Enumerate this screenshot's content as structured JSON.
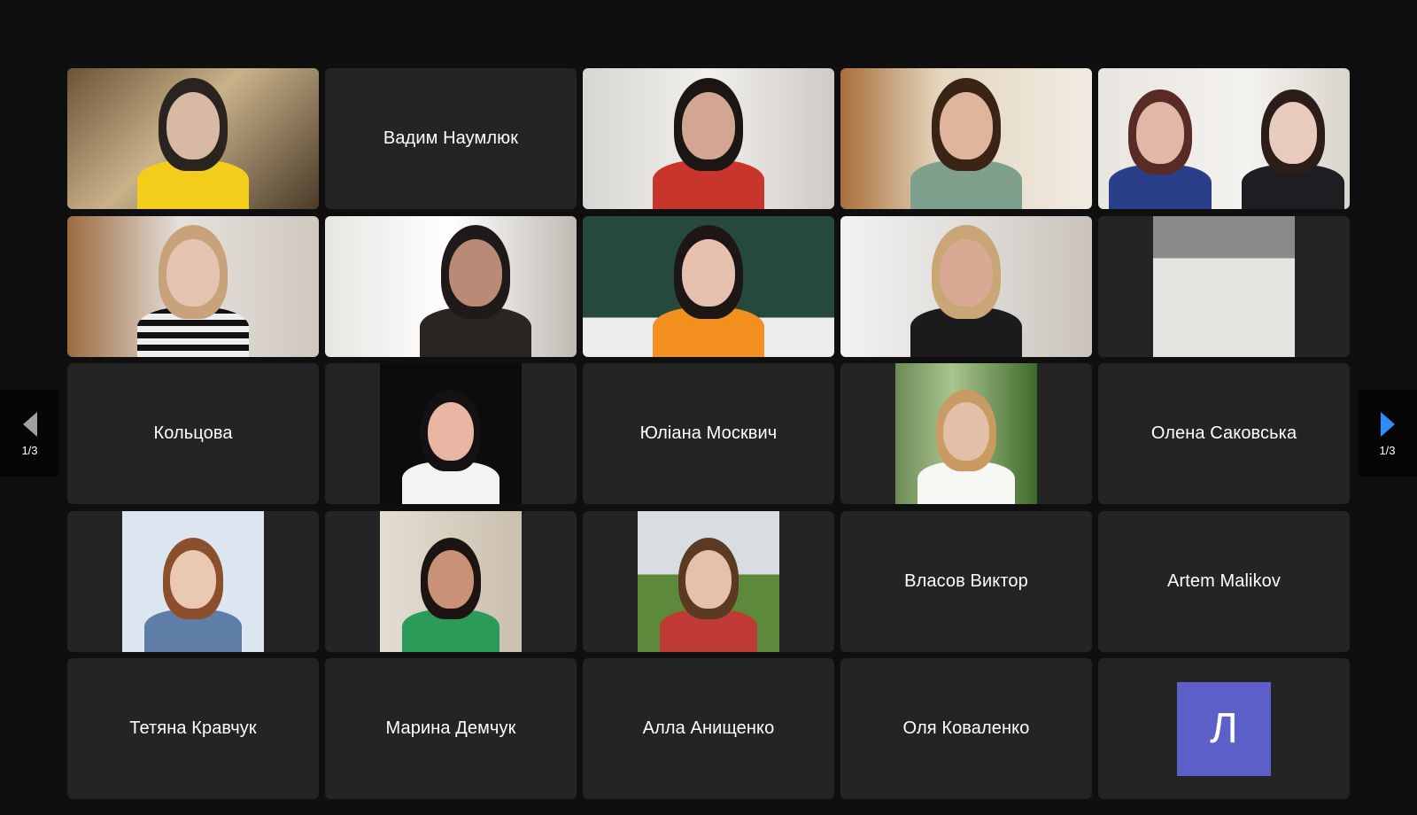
{
  "participants": [
    {
      "name": "",
      "type": "video",
      "active": true
    },
    {
      "name": "Вадим Наумлюк",
      "type": "name"
    },
    {
      "name": "",
      "type": "video"
    },
    {
      "name": "",
      "type": "video"
    },
    {
      "name": "",
      "type": "video"
    },
    {
      "name": "",
      "type": "video"
    },
    {
      "name": "",
      "type": "video"
    },
    {
      "name": "",
      "type": "video"
    },
    {
      "name": "",
      "type": "video"
    },
    {
      "name": "",
      "type": "photo"
    },
    {
      "name": "Кольцова",
      "type": "name"
    },
    {
      "name": "",
      "type": "photo"
    },
    {
      "name": "Юліана Москвич",
      "type": "name"
    },
    {
      "name": "",
      "type": "photo"
    },
    {
      "name": "Олена Саковська",
      "type": "name"
    },
    {
      "name": "",
      "type": "photo"
    },
    {
      "name": "",
      "type": "photo"
    },
    {
      "name": "",
      "type": "photo"
    },
    {
      "name": "Власов Виктор",
      "type": "name"
    },
    {
      "name": "Artem Malikov",
      "type": "name"
    },
    {
      "name": "Тетяна Кравчук",
      "type": "name"
    },
    {
      "name": "Марина Демчук",
      "type": "name"
    },
    {
      "name": "Алла Анищенко",
      "type": "name"
    },
    {
      "name": "Оля Коваленко",
      "type": "name"
    },
    {
      "name": "",
      "type": "avatar",
      "initial": "Л"
    }
  ],
  "pagination": {
    "prev_label": "1/3",
    "next_label": "1/3"
  },
  "colors": {
    "active_border": "#29a844",
    "avatar_bg": "#5b5fc7",
    "tile_bg": "#242424",
    "next_arrow": "#2d8cff"
  }
}
